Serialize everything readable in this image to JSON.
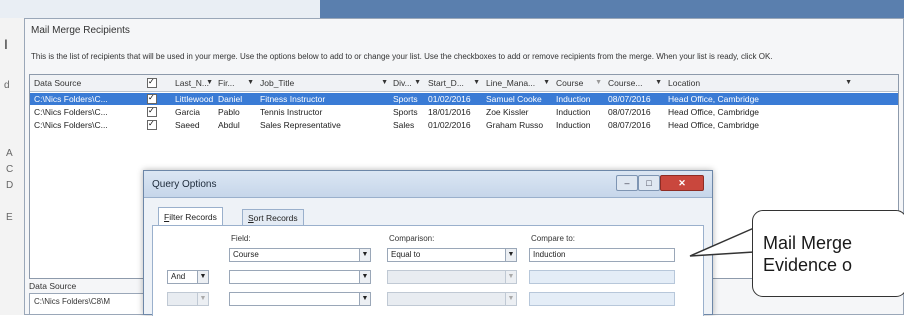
{
  "host": {
    "left_glyphs": [
      "I",
      "d",
      "A",
      "C",
      "D",
      "E"
    ]
  },
  "mail_merge_recipients": {
    "title": "Mail Merge Recipients",
    "description": "This is the list of recipients that will be used in your merge.  Use the options below to add to or change your list.  Use the checkboxes to add or remove recipients from the merge.  When your list is ready, click OK.",
    "columns": [
      "Data Source",
      "",
      "Last_N...",
      "Fir...",
      "Job_Title",
      "Div...",
      "Start_D...",
      "Line_Mana...",
      "Course",
      "Course...",
      "Location"
    ],
    "rows": [
      {
        "selected": true,
        "checked": true,
        "cells": [
          "C:\\Nics Folders\\C...",
          "",
          "Littlewood",
          "Daniel",
          "Fitness Instructor",
          "Sports",
          "01/02/2016",
          "Samuel Cooke",
          "Induction",
          "08/07/2016",
          "Head Office, Cambridge"
        ]
      },
      {
        "selected": false,
        "checked": true,
        "cells": [
          "C:\\Nics Folders\\C...",
          "",
          "Garcia",
          "Pablo",
          "Tennis Instructor",
          "Sports",
          "18/01/2016",
          "Zoe Kissler",
          "Induction",
          "08/07/2016",
          "Head Office, Cambridge"
        ]
      },
      {
        "selected": false,
        "checked": true,
        "cells": [
          "C:\\Nics Folders\\C...",
          "",
          "Saeed",
          "Abdul",
          "Sales Representative",
          "Sales",
          "01/02/2016",
          "Graham Russo",
          "Induction",
          "08/07/2016",
          "Head Office, Cambridge"
        ]
      }
    ],
    "data_source_label": "Data Source",
    "data_source_value": "C:\\Nics Folders\\C8\\M"
  },
  "query_options": {
    "title": "Query Options",
    "tabs": [
      {
        "label_mnemonic": "F",
        "label_rest": "ilter Records",
        "active": true
      },
      {
        "label_mnemonic": "S",
        "label_rest": "ort Records",
        "active": false
      }
    ],
    "field_label": "Field:",
    "comparison_label": "Comparison:",
    "compare_to_label": "Compare to:",
    "row1": {
      "field": "Course",
      "comparison": "Equal to",
      "compare_to": "Induction"
    },
    "row2": {
      "connector": "And"
    }
  },
  "callout": {
    "line1": "Mail Merge",
    "line2": "Evidence o"
  },
  "colors": {
    "selection": "#3a7bd5",
    "host_blue": "#5a7fae",
    "close_button": "#c9473d"
  }
}
